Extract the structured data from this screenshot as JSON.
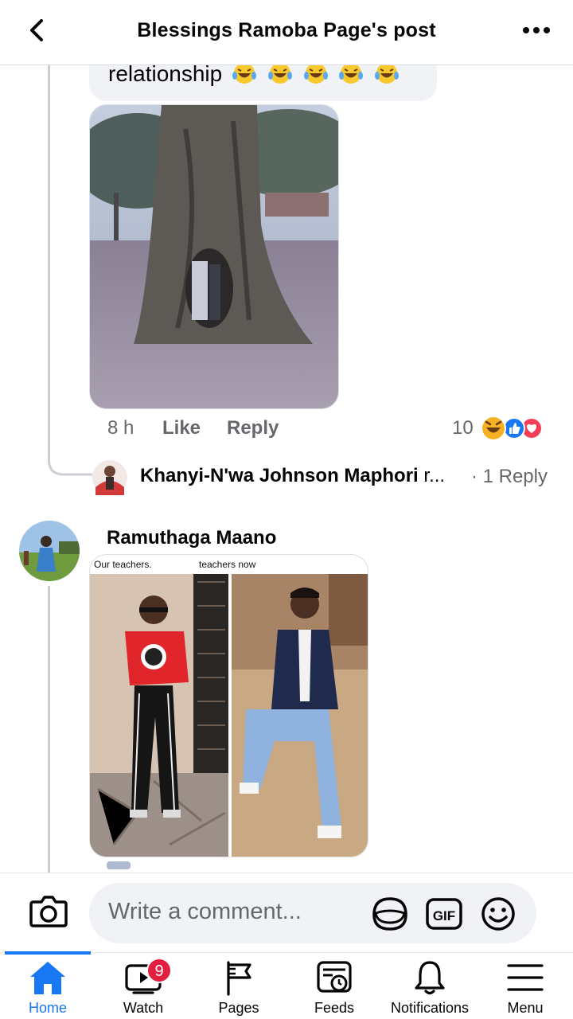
{
  "header": {
    "title": "Blessings Ramoba Page's post"
  },
  "comment_1": {
    "text_tail": "relationship",
    "emojis": [
      "laughing-emoji",
      "laughing-emoji",
      "laughing-emoji",
      "laughing-emoji",
      "laughing-emoji"
    ],
    "time": "8 h",
    "like_label": "Like",
    "reply_label": "Reply",
    "reaction_count": "10",
    "reactions": [
      "haha-reaction-icon",
      "like-reaction-icon",
      "love-reaction-icon"
    ]
  },
  "reply_preview": {
    "name": "Khanyi-N'wa Johnson Maphori",
    "truncated": "r...",
    "count": "· 1 Reply"
  },
  "comment_2": {
    "author": "Ramuthaga Maano",
    "meme_left_caption": "Our teachers.",
    "meme_right_caption": "teachers now"
  },
  "composer": {
    "placeholder": "Write a comment..."
  },
  "nav": {
    "items": [
      {
        "label": "Home",
        "icon": "home-icon",
        "active": true
      },
      {
        "label": "Watch",
        "icon": "watch-icon",
        "badge": "9"
      },
      {
        "label": "Pages",
        "icon": "pages-icon"
      },
      {
        "label": "Feeds",
        "icon": "feeds-icon"
      },
      {
        "label": "Notifications",
        "icon": "bell-icon"
      },
      {
        "label": "Menu",
        "icon": "menu-icon"
      }
    ]
  },
  "colors": {
    "accent": "#1877f2",
    "badge": "#e41e3f",
    "love": "#f33e58",
    "haha": "#f7b125"
  }
}
